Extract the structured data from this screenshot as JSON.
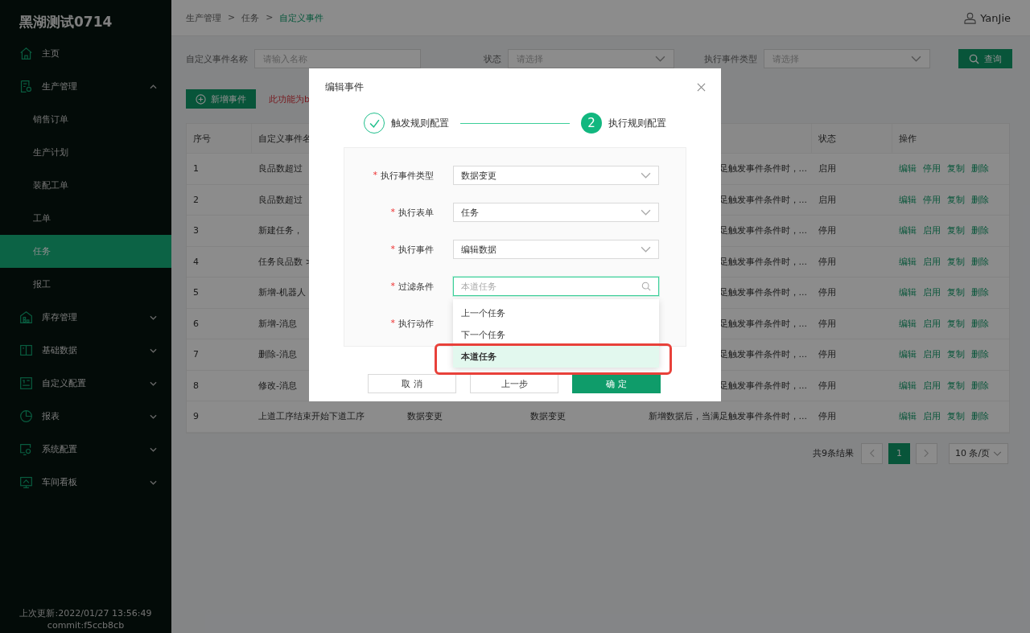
{
  "sidebar": {
    "brand": "黑湖测试0714",
    "items": [
      {
        "label": "主页",
        "kind": "home",
        "selected": false
      },
      {
        "label": "生产管理",
        "kind": "factory",
        "selected": false,
        "expanded": true,
        "children": [
          {
            "label": "销售订单",
            "selected": false
          },
          {
            "label": "生产计划",
            "selected": false
          },
          {
            "label": "装配工单",
            "selected": false
          },
          {
            "label": "工单",
            "selected": false
          },
          {
            "label": "任务",
            "selected": true
          },
          {
            "label": "报工",
            "selected": false
          }
        ]
      },
      {
        "label": "库存管理",
        "kind": "warehouse",
        "selected": false,
        "expanded": false
      },
      {
        "label": "基础数据",
        "kind": "book",
        "selected": false,
        "expanded": false
      },
      {
        "label": "自定义配置",
        "kind": "form",
        "selected": false,
        "expanded": false
      },
      {
        "label": "报表",
        "kind": "pie",
        "selected": false,
        "expanded": false
      },
      {
        "label": "系统配置",
        "kind": "monitor-gear",
        "selected": false,
        "expanded": false
      },
      {
        "label": "车间看板",
        "kind": "monitor",
        "selected": false,
        "expanded": false
      }
    ],
    "footer": [
      "上次更新:2022/01/27 13:56:49",
      "commit:f5ccb8cb"
    ]
  },
  "header": {
    "breadcrumb": [
      {
        "label": "生产管理",
        "current": false
      },
      {
        "label": ">",
        "current": false
      },
      {
        "label": "任务",
        "current": false
      },
      {
        "label": ">",
        "current": false
      },
      {
        "label": "自定义事件",
        "current": true
      }
    ],
    "user": "YanJie"
  },
  "filters": [
    {
      "label": "自定义事件名称",
      "placeholder": "请输入名称",
      "kind": "text"
    },
    {
      "label": "状态",
      "placeholder": "请选择",
      "kind": "select"
    },
    {
      "label": "执行事件类型",
      "placeholder": "请选择",
      "kind": "select"
    }
  ],
  "search_button": "查询",
  "add_button": "新增事件",
  "notice": "此功能为b",
  "table": {
    "columns": [
      "序号",
      "自定义事件名",
      "状态",
      "操作"
    ],
    "rows": [
      {
        "index": "1",
        "name": "良品数超过",
        "column_5": "足触发事件条件时，...",
        "status": "启用",
        "actions": [
          "编辑",
          "停用",
          "复制",
          "删除"
        ]
      },
      {
        "index": "2",
        "name": "良品数超过",
        "column_5": "足触发事件条件时，...",
        "status": "启用",
        "actions": [
          "编辑",
          "停用",
          "复制",
          "删除"
        ]
      },
      {
        "index": "3",
        "name": "新建任务，",
        "column_5": "足触发事件条件时，...",
        "status": "停用",
        "actions": [
          "编辑",
          "启用",
          "复制",
          "删除"
        ]
      },
      {
        "index": "4",
        "name": "任务良品数 >",
        "column_5": "足触发事件条件时，...",
        "status": "停用",
        "actions": [
          "编辑",
          "启用",
          "复制",
          "删除"
        ]
      },
      {
        "index": "5",
        "name": "新增-机器人",
        "column_5": "足触发事件条件时，...",
        "status": "停用",
        "actions": [
          "编辑",
          "启用",
          "复制",
          "删除"
        ]
      },
      {
        "index": "6",
        "name": "新增-消息",
        "column_5": "足触发事件条件时，...",
        "status": "停用",
        "actions": [
          "编辑",
          "启用",
          "复制",
          "删除"
        ]
      },
      {
        "index": "7",
        "name": "删除-消息",
        "column_5": "足触发事件条件时，...",
        "status": "停用",
        "actions": [
          "编辑",
          "启用",
          "复制",
          "删除"
        ]
      },
      {
        "index": "8",
        "name": "修改-消息",
        "column_5": "足触发事件条件时，...",
        "status": "停用",
        "actions": [
          "编辑",
          "启用",
          "复制",
          "删除"
        ]
      },
      {
        "index": "9",
        "name": "上道工序结束开始下道工序",
        "column_3": "数据变更",
        "column_4": "数据变更",
        "column_5": "新增数据后，当满足触发事件条件时，...",
        "status": "停用",
        "actions": [
          "编辑",
          "启用",
          "复制",
          "删除"
        ]
      }
    ]
  },
  "pagination": {
    "total": "共9条结果",
    "pages": [
      {
        "label": "1",
        "selected": true
      }
    ],
    "page_size": "10 条/页"
  },
  "modal": {
    "title": "编辑事件",
    "steps": [
      {
        "label": "触发规则配置",
        "done": true
      },
      {
        "label": "执行规则配置",
        "number": "2",
        "done": false
      }
    ],
    "fields": [
      {
        "marker": "*",
        "label": "执行事件类型",
        "kind": "select",
        "value": "数据变更"
      },
      {
        "marker": "*",
        "label": "执行表单",
        "kind": "select",
        "value": "任务"
      },
      {
        "marker": "*",
        "label": "执行事件",
        "kind": "select",
        "value": "编辑数据"
      },
      {
        "marker": "*",
        "label": "过滤条件",
        "kind": "search",
        "placeholder": "本道任务",
        "focused": true
      },
      {
        "marker": "*",
        "label": "执行动作",
        "kind": "hidden"
      }
    ],
    "dropdown": [
      {
        "label": "上一个任务",
        "selected": false
      },
      {
        "label": "下一个任务",
        "selected": false
      },
      {
        "label": "本道任务",
        "selected": true
      }
    ],
    "buttons": [
      {
        "label": "取 消",
        "kind": "default"
      },
      {
        "label": "上一步",
        "kind": "default"
      },
      {
        "label": "确 定",
        "kind": "primary"
      }
    ]
  }
}
